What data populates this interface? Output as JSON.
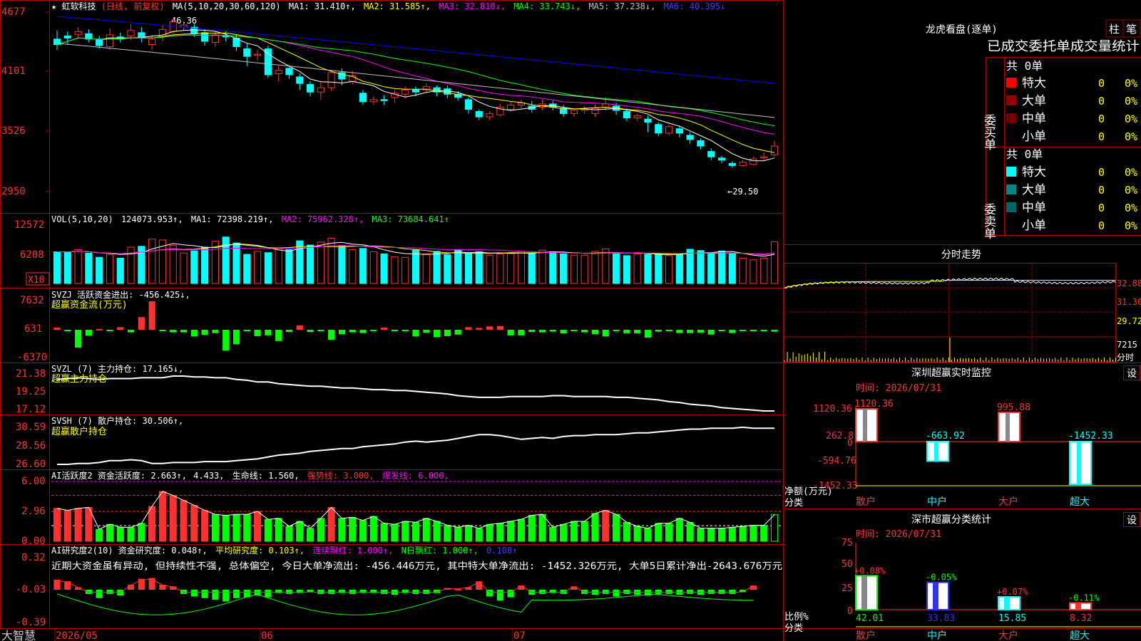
{
  "colors": {
    "up": "#ff3030",
    "down": "#00ffff",
    "grid": "#aa0000",
    "green_bar": "#00ff00",
    "ma1": "#ffffff",
    "ma2": "#ffff00",
    "ma3": "#ff00ff",
    "ma4": "#00ff00",
    "ma5": "#c0c0c0",
    "ma6": "#0000ff",
    "yellow": "#ffff00",
    "axis_text": "#ff3030"
  },
  "header": {
    "star": "★",
    "name": "虹软科技",
    "mode": "(日线, 前复权)",
    "ma_params": "MA(5,10,20,30,60,120)",
    "ma1": "MA1: 31.410↑,",
    "ma2": "MA2: 31.585↑,",
    "ma3": "MA3: 32.810↓,",
    "ma4": "MA4: 33.743↓,",
    "ma5": "MA5: 37.238↓,",
    "ma6": "MA6: 40.395↓"
  },
  "price_axis": [
    "4677",
    "4101",
    "3526",
    "2950"
  ],
  "price_annotations": {
    "high": "46.36",
    "low": "←29.50"
  },
  "vol_panel": {
    "title": "VOL(5,10,20)",
    "value": "124073.953↑,",
    "ma1": "MA1: 72398.219↑,",
    "ma2": "MA2: 75962.328↑,",
    "ma3": "MA3: 73684.641↑",
    "axis": [
      "12572",
      "6208"
    ],
    "unit": "X10"
  },
  "svzj_panel": {
    "title": "SVZJ  活跃资金进出: -456.425↓,",
    "subtitle": "超赢资金流(万元)",
    "axis": [
      "7632",
      "631",
      "-6370"
    ]
  },
  "svzl_panel": {
    "title": "SVZL (7) 主力持仓: 17.165↓,",
    "subtitle": "超赢主力持仓",
    "axis": [
      "21.38",
      "19.25",
      "17.12"
    ]
  },
  "svsh_panel": {
    "title": "SVSH (7) 散户持仓: 30.506↑,",
    "subtitle": "超赢散户持仓",
    "axis": [
      "30.59",
      "28.56",
      "26.60"
    ]
  },
  "active_panel": {
    "title": "AI活跃度2 资金活跃度: 2.663↑,",
    "v2": "4.433,",
    "life": "生命线: 1.560,",
    "strong": "强势线: 3.000,",
    "burst": "爆发线: 6.000,",
    "axis": [
      "6.00",
      "2.96",
      "0.00"
    ]
  },
  "research_panel": {
    "title": "AI研究度2(10) 资金研究度: 0.048↑,",
    "avg": "平均研究度: 0.103↑,",
    "cont": "连续飘红: 1.000↑,",
    "nday": "N日飘红: 1.000↑,",
    "last": "0.108↑",
    "comment": "近期大资金虽有异动, 但持续性不强, 总体偏空, 今日大单净流出: -456.446万元, 其中特大单净流出: -1452.326万元, 大单5日累计净出-2643.676万元",
    "axis": [
      "0.32",
      "-0.03",
      "-0.39"
    ]
  },
  "date_axis": {
    "brand": "大智慧",
    "labels": [
      "2026/05",
      "06",
      "07"
    ]
  },
  "right": {
    "tabs": [
      "柱",
      "笔"
    ],
    "dragon_title": "龙虎看盘(逐单)",
    "stats_title": "已成交委托单成交量统计",
    "buy": {
      "label": "委买单",
      "total": "共 0单",
      "rows": [
        {
          "name": "特大",
          "count": "0",
          "pct": "0%",
          "color": "#ff0000"
        },
        {
          "name": "大单",
          "count": "0",
          "pct": "0%",
          "color": "#990000"
        },
        {
          "name": "中单",
          "count": "0",
          "pct": "0%",
          "color": "#770000"
        },
        {
          "name": "小单",
          "count": "0",
          "pct": "0%",
          "color": ""
        }
      ]
    },
    "sell": {
      "label": "委卖单",
      "total": "共 0单",
      "rows": [
        {
          "name": "特大",
          "count": "0",
          "pct": "0%",
          "color": "#00ffff"
        },
        {
          "name": "大单",
          "count": "0",
          "pct": "0%",
          "color": "#008888"
        },
        {
          "name": "中单",
          "count": "0",
          "pct": "0%",
          "color": "#006666"
        },
        {
          "name": "小单",
          "count": "0",
          "pct": "0%",
          "color": ""
        }
      ]
    },
    "intraday": {
      "title": "分时走势",
      "axis": [
        "32.88",
        "31.30",
        "29.72",
        "7215",
        "分时"
      ]
    },
    "monitor": {
      "title": "深圳超赢实时监控",
      "settings": "设",
      "time": "时间: 2026/07/31",
      "axis": [
        "1120.36",
        "262.8",
        "0",
        "-594.76",
        "-1452.33"
      ],
      "ylabel": "净额(万元)",
      "xlabel": "分类",
      "categories": [
        "散户",
        "中户",
        "大户",
        "超大"
      ],
      "values": [
        1120.36,
        -663.92,
        995.88,
        -1452.33
      ],
      "labels": [
        "1120.36",
        "-663.92",
        "995.88",
        "-1452.33"
      ]
    },
    "classify": {
      "title": "深市超赢分类统计",
      "settings": "设",
      "time": "时间: 2026/07/31",
      "axis": [
        "75",
        "50",
        "25",
        "0"
      ],
      "ylabel": "比例%",
      "xlabel": "分类",
      "categories": [
        "散户",
        "中户",
        "大户",
        "超大"
      ],
      "values": [
        42.01,
        33.83,
        15.85,
        8.32
      ],
      "value_labels": [
        "42.01",
        "33.83",
        "15.85",
        "8.32"
      ],
      "changes": [
        "+0.08%",
        "-0.05%",
        "+0.07%",
        "-0.11%"
      ],
      "bar_colors": [
        "#00ff00",
        "#3030ff",
        "#00ffff",
        "#ff3030"
      ]
    }
  },
  "chart_data": [
    {
      "type": "candlestick",
      "ylim": [
        29.0,
        47.0
      ],
      "candles": [
        [
          44.5,
          44.0,
          45.3,
          43.5
        ],
        [
          44.8,
          44.6,
          45.2,
          44.0
        ],
        [
          44.9,
          45.2,
          45.6,
          44.5
        ],
        [
          45.0,
          44.5,
          45.4,
          44.2
        ],
        [
          44.5,
          43.9,
          44.8,
          43.6
        ],
        [
          43.8,
          44.9,
          45.5,
          43.5
        ],
        [
          44.7,
          44.5,
          45.1,
          44.2
        ],
        [
          44.8,
          45.3,
          45.9,
          44.4
        ],
        [
          45.1,
          44.7,
          45.6,
          44.2
        ],
        [
          44.0,
          44.5,
          44.9,
          43.5
        ],
        [
          44.7,
          45.4,
          45.8,
          44.3
        ],
        [
          45.2,
          46.1,
          46.36,
          45.0
        ],
        [
          45.6,
          45.8,
          46.2,
          45.3
        ],
        [
          45.6,
          45.0,
          45.9,
          44.7
        ],
        [
          45.1,
          44.3,
          45.4,
          43.9
        ],
        [
          44.2,
          44.9,
          45.2,
          43.8
        ],
        [
          44.8,
          44.7,
          45.2,
          44.3
        ],
        [
          44.6,
          43.8,
          44.9,
          43.4
        ],
        [
          43.6,
          42.9,
          44.1,
          42.0
        ],
        [
          43.0,
          43.1,
          43.5,
          42.5
        ],
        [
          43.6,
          41.2,
          43.9,
          40.9
        ],
        [
          41.3,
          41.6,
          42.0,
          40.6
        ],
        [
          41.8,
          41.2,
          42.1,
          40.8
        ],
        [
          41.0,
          40.4,
          41.3,
          39.8
        ],
        [
          40.3,
          39.6,
          40.6,
          39.2
        ],
        [
          39.6,
          40.0,
          40.5,
          38.9
        ],
        [
          40.0,
          41.4,
          41.6,
          39.7
        ],
        [
          41.4,
          40.8,
          41.8,
          40.2
        ],
        [
          40.6,
          41.1,
          41.5,
          40.3
        ],
        [
          39.5,
          38.7,
          39.8,
          38.4
        ],
        [
          38.7,
          38.9,
          39.2,
          38.4
        ],
        [
          38.9,
          38.8,
          39.3,
          38.4
        ],
        [
          39.1,
          39.5,
          39.8,
          38.6
        ],
        [
          39.4,
          39.8,
          40.1,
          39.0
        ],
        [
          39.8,
          39.6,
          40.1,
          39.2
        ],
        [
          39.8,
          40.1,
          40.4,
          39.5
        ],
        [
          40.0,
          39.6,
          40.2,
          39.2
        ],
        [
          39.9,
          39.4,
          40.2,
          39.0
        ],
        [
          39.4,
          39.1,
          39.7,
          38.8
        ],
        [
          38.9,
          38.0,
          39.1,
          37.6
        ],
        [
          37.8,
          37.3,
          38.0,
          37.0
        ],
        [
          37.3,
          37.6,
          37.8,
          37.0
        ],
        [
          37.5,
          38.2,
          38.5,
          37.3
        ],
        [
          38.0,
          38.4,
          38.7,
          37.8
        ],
        [
          38.4,
          38.6,
          38.9,
          38.1
        ],
        [
          38.3,
          38.0,
          38.8,
          37.7
        ],
        [
          38.2,
          38.5,
          38.9,
          37.9
        ],
        [
          38.5,
          38.2,
          38.8,
          37.9
        ],
        [
          38.1,
          37.6,
          38.4,
          37.3
        ],
        [
          37.6,
          37.9,
          38.1,
          37.3
        ],
        [
          37.9,
          38.0,
          38.3,
          37.6
        ],
        [
          37.6,
          38.1,
          38.4,
          37.3
        ],
        [
          38.2,
          38.5,
          39.1,
          37.9
        ],
        [
          38.3,
          37.9,
          38.6,
          37.5
        ],
        [
          37.8,
          37.2,
          38.1,
          36.9
        ],
        [
          37.2,
          37.4,
          37.6,
          36.9
        ],
        [
          37.1,
          36.8,
          37.4,
          35.9
        ],
        [
          36.6,
          35.8,
          36.8,
          35.5
        ],
        [
          35.8,
          36.4,
          36.6,
          35.6
        ],
        [
          36.2,
          35.8,
          36.5,
          35.4
        ],
        [
          35.6,
          35.2,
          35.9,
          34.8
        ],
        [
          35.1,
          34.6,
          35.3,
          34.3
        ],
        [
          34.1,
          33.6,
          34.4,
          33.3
        ],
        [
          33.5,
          33.3,
          33.7,
          33.0
        ],
        [
          33.0,
          32.8,
          33.2,
          32.6
        ],
        [
          32.8,
          33.1,
          33.3,
          32.7
        ],
        [
          32.9,
          33.4,
          33.6,
          32.8
        ],
        [
          33.5,
          33.6,
          34.0,
          33.3
        ],
        [
          33.8,
          34.6,
          35.1,
          33.6
        ]
      ]
    },
    {
      "type": "bar",
      "name": "VOL",
      "values": [
        75,
        74,
        80,
        72,
        62,
        69,
        60,
        86,
        88,
        105,
        103,
        90,
        72,
        77,
        86,
        100,
        110,
        96,
        69,
        76,
        73,
        83,
        80,
        101,
        91,
        98,
        107,
        90,
        80,
        83,
        75,
        70,
        63,
        62,
        79,
        70,
        76,
        68,
        80,
        71,
        75,
        67,
        70,
        72,
        76,
        72,
        79,
        75,
        70,
        67,
        67,
        76,
        82,
        70,
        66,
        70,
        69,
        70,
        66,
        68,
        81,
        78,
        73,
        77,
        70,
        60,
        56,
        60,
        99
      ]
    },
    {
      "type": "bar",
      "name": "超赢资金流",
      "values": [
        600,
        -400,
        -4800,
        -1600,
        200,
        -200,
        700,
        -700,
        3400,
        7632,
        -200,
        -700,
        -700,
        -1800,
        -1400,
        -900,
        -5600,
        -3900,
        -400,
        -1700,
        -1500,
        -3000,
        -600,
        1200,
        -600,
        -400,
        -2700,
        -1200,
        -700,
        -900,
        -400,
        600,
        -300,
        -400,
        -1800,
        -800,
        -2000,
        -1700,
        -1300,
        700,
        500,
        900,
        1000,
        -1500,
        -1500,
        -600,
        -700,
        -500,
        -1000,
        -400,
        -700,
        -1200,
        -1800,
        -300,
        -1000,
        -1000,
        -2100,
        -500,
        -400,
        -900,
        -900,
        -800,
        -1300,
        -400,
        -900,
        -200,
        -400,
        -400,
        -500
      ]
    },
    {
      "type": "line",
      "name": "SVZL",
      "ylim": [
        17.12,
        21.38
      ],
      "values": [
        20.9,
        21.0,
        21.1,
        21.0,
        20.9,
        21.0,
        21.0,
        21.0,
        21.1,
        21.1,
        21.1,
        21.3,
        21.3,
        21.2,
        21.2,
        21.1,
        21.1,
        20.9,
        20.8,
        20.6,
        20.6,
        20.4,
        20.3,
        20.2,
        20.1,
        20.1,
        20.0,
        19.9,
        19.9,
        19.8,
        19.7,
        19.7,
        19.6,
        19.6,
        19.5,
        19.4,
        19.3,
        19.2,
        19.0,
        18.9,
        18.8,
        18.8,
        18.8,
        18.9,
        18.9,
        18.9,
        18.9,
        19.0,
        19.0,
        18.9,
        18.9,
        18.9,
        18.9,
        18.8,
        18.8,
        18.7,
        18.6,
        18.5,
        18.3,
        18.2,
        18.0,
        17.9,
        17.8,
        17.6,
        17.5,
        17.4,
        17.3,
        17.2,
        17.2
      ]
    },
    {
      "type": "line",
      "name": "SVSH",
      "ylim": [
        26.6,
        30.59
      ],
      "values": [
        26.6,
        26.6,
        26.7,
        26.7,
        26.8,
        27.0,
        27.0,
        27.1,
        27.0,
        26.7,
        26.7,
        26.8,
        26.8,
        26.8,
        26.9,
        26.9,
        26.9,
        27.0,
        27.1,
        27.2,
        27.4,
        27.6,
        27.7,
        27.8,
        28.0,
        28.1,
        28.2,
        28.3,
        28.3,
        28.5,
        28.6,
        28.7,
        28.8,
        29.0,
        29.1,
        29.0,
        29.1,
        29.2,
        29.4,
        29.6,
        29.8,
        29.8,
        29.7,
        29.5,
        29.3,
        29.4,
        29.5,
        29.4,
        29.6,
        29.7,
        29.7,
        29.8,
        29.8,
        29.8,
        29.9,
        30.0,
        30.0,
        30.1,
        30.2,
        30.3,
        30.4,
        30.4,
        30.5,
        30.5,
        30.5,
        30.6,
        30.5,
        30.5,
        30.5
      ]
    },
    {
      "type": "bar",
      "name": "资金活跃度",
      "ylim": [
        0,
        6.0
      ],
      "values": [
        3.3,
        3.1,
        3.3,
        3.4,
        1.2,
        1.7,
        1.4,
        1.4,
        1.8,
        3.5,
        5.0,
        4.6,
        4.1,
        3.6,
        3.1,
        2.7,
        2.6,
        2.7,
        2.7,
        3.0,
        2.2,
        2.3,
        1.5,
        2.0,
        1.3,
        2.3,
        3.4,
        2.3,
        2.4,
        2.1,
        2.5,
        1.8,
        1.7,
        2.0,
        1.9,
        2.3,
        2.0,
        1.6,
        1.4,
        1.6,
        1.3,
        1.7,
        1.8,
        2.0,
        2.2,
        2.6,
        2.7,
        1.4,
        1.7,
        2.0,
        2.0,
        2.8,
        3.1,
        2.7,
        1.9,
        1.5,
        1.3,
        1.8,
        1.8,
        2.3,
        1.9,
        1.3,
        1.3,
        1.3,
        1.4,
        1.5,
        1.6,
        1.6,
        2.66
      ]
    },
    {
      "type": "bar",
      "name": "资金研究度",
      "ylim": [
        -0.39,
        0.32
      ],
      "values": [
        0.12,
        0.1,
        0.03,
        -0.05,
        -0.1,
        -0.05,
        -0.07,
        0.06,
        0.13,
        0.14,
        0.06,
        0.04,
        -0.05,
        -0.08,
        -0.1,
        -0.12,
        -0.14,
        -0.1,
        -0.09,
        -0.07,
        -0.09,
        -0.04,
        -0.05,
        -0.04,
        -0.03,
        -0.05,
        -0.05,
        -0.04,
        -0.05,
        -0.04,
        -0.04,
        -0.05,
        -0.06,
        -0.04,
        -0.05,
        -0.05,
        -0.04,
        0.02,
        0.01,
        0.03,
        0.1,
        -0.08,
        -0.13,
        -0.09,
        0.05,
        -0.06,
        -0.05,
        -0.04,
        -0.05,
        0.04,
        -0.05,
        -0.06,
        -0.05,
        -0.08,
        -0.05,
        -0.06,
        -0.07,
        -0.05,
        -0.05,
        -0.06,
        -0.05,
        -0.06,
        -0.05,
        -0.05,
        -0.05,
        -0.03,
        0.05
      ]
    },
    {
      "type": "bar",
      "name": "深圳超赢实时监控",
      "categories": [
        "散户",
        "中户",
        "大户",
        "超大"
      ],
      "values": [
        1120.36,
        -663.92,
        995.88,
        -1452.33
      ],
      "ylim": [
        -1452.33,
        1120.36
      ]
    },
    {
      "type": "bar",
      "name": "深市超赢分类统计",
      "categories": [
        "散户",
        "中户",
        "大户",
        "超大"
      ],
      "values": [
        42.01,
        33.83,
        15.85,
        8.32
      ],
      "ylim": [
        0,
        75
      ]
    }
  ]
}
